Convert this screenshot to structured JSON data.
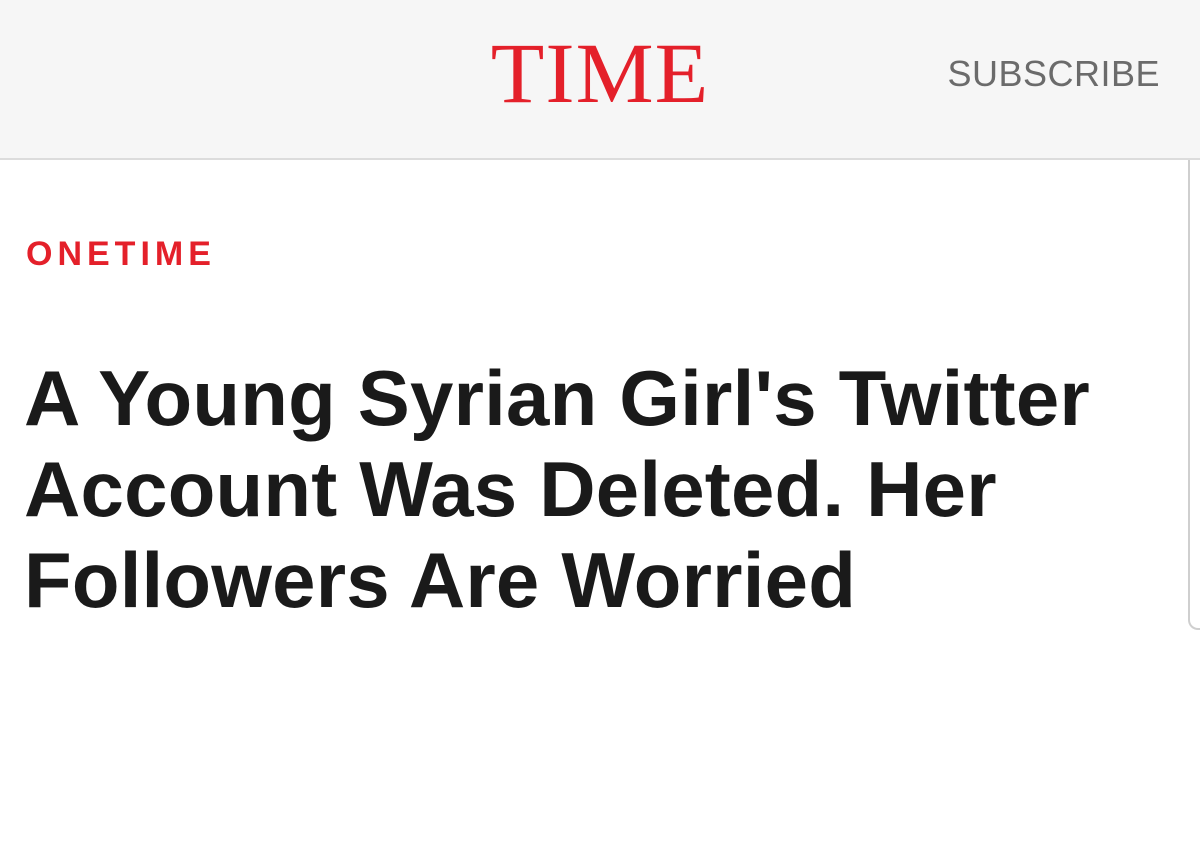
{
  "header": {
    "logo_text": "TIME",
    "subscribe_label": "SUBSCRIBE",
    "logo_color": "#e4202a",
    "background_color": "#f6f6f6"
  },
  "article": {
    "section_label": "ONETIME",
    "headline": "A Young Syrian Girl's Twitter Account Was Deleted. Her Followers Are Worried",
    "accent_color": "#e4202a",
    "headline_color": "#1a1a1a"
  }
}
